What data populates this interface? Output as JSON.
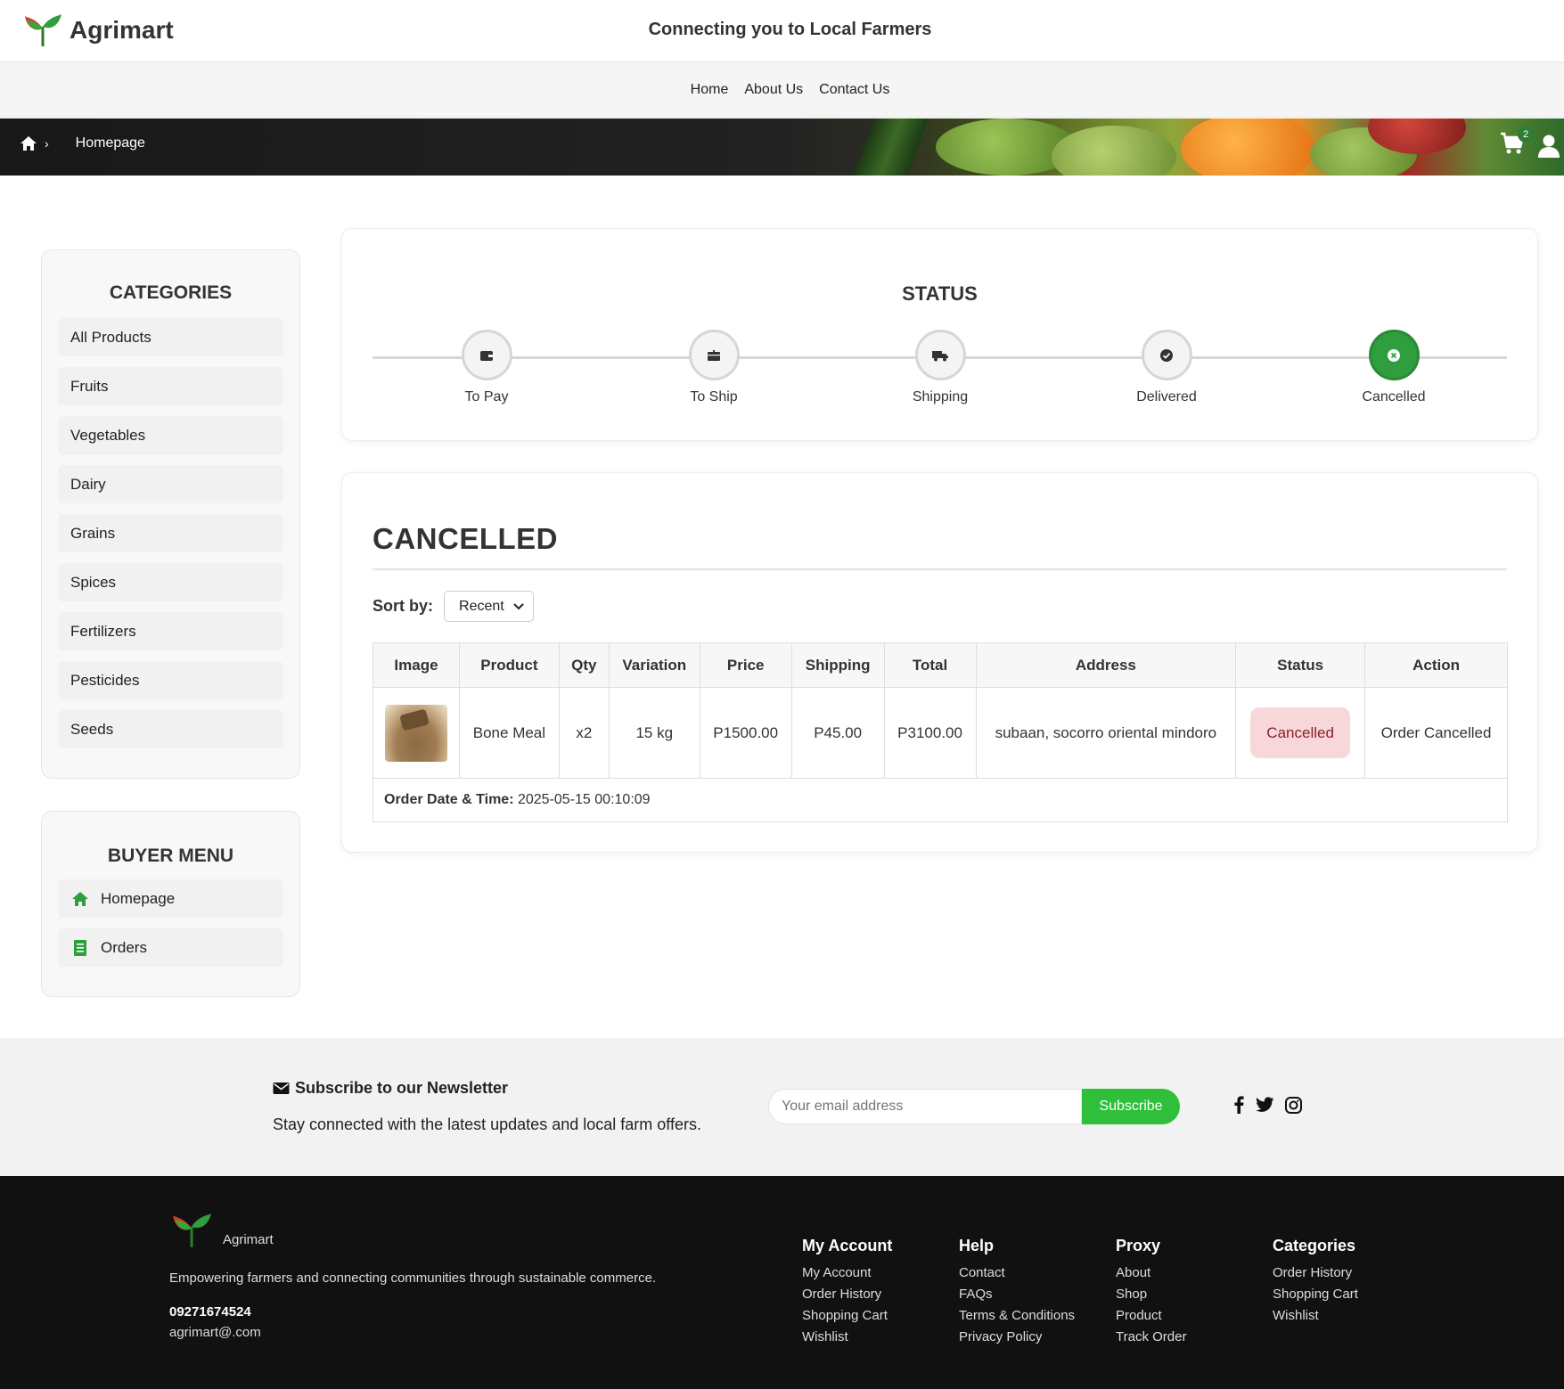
{
  "header": {
    "brand": "Agrimart",
    "tagline": "Connecting you to Local Farmers"
  },
  "nav": {
    "links": [
      "Home",
      "About Us",
      "Contact Us"
    ]
  },
  "breadcrumb": {
    "current": "Homepage",
    "separator": "›"
  },
  "cart": {
    "count": "2"
  },
  "sidebar": {
    "categories_title": "CATEGORIES",
    "categories": [
      "All Products",
      "Fruits",
      "Vegetables",
      "Dairy",
      "Grains",
      "Spices",
      "Fertilizers",
      "Pesticides",
      "Seeds"
    ],
    "buyer_menu_title": "BUYER MENU",
    "buyer_menu": [
      {
        "label": "Homepage",
        "icon": "home-icon"
      },
      {
        "label": "Orders",
        "icon": "receipt-icon"
      }
    ]
  },
  "status": {
    "title": "STATUS",
    "steps": [
      {
        "label": "To Pay",
        "icon": "wallet-icon",
        "active": false
      },
      {
        "label": "To Ship",
        "icon": "box-icon",
        "active": false
      },
      {
        "label": "Shipping",
        "icon": "truck-icon",
        "active": false
      },
      {
        "label": "Delivered",
        "icon": "check-circle-icon",
        "active": false
      },
      {
        "label": "Cancelled",
        "icon": "x-circle-icon",
        "active": true
      }
    ]
  },
  "orders": {
    "title": "CANCELLED",
    "sort_label": "Sort by:",
    "sort_value": "Recent",
    "columns": [
      "Image",
      "Product",
      "Qty",
      "Variation",
      "Price",
      "Shipping",
      "Total",
      "Address",
      "Status",
      "Action"
    ],
    "rows": [
      {
        "product": "Bone Meal",
        "qty": "x2",
        "variation": "15 kg",
        "price": "P1500.00",
        "shipping": "P45.00",
        "total": "P3100.00",
        "address": "subaan, socorro oriental mindoro",
        "status": "Cancelled",
        "action": "Order Cancelled",
        "order_date_label": "Order Date & Time:",
        "order_date": "2025-05-15 00:10:09"
      }
    ]
  },
  "newsletter": {
    "title": "Subscribe to our Newsletter",
    "subtitle": "Stay connected with the latest updates and local farm offers.",
    "placeholder": "Your email address",
    "button": "Subscribe"
  },
  "footer": {
    "brand": "Agrimart",
    "description": "Empowering farmers and connecting communities through sustainable commerce.",
    "phone": "09271674524",
    "email": "agrimart@.com",
    "columns": [
      {
        "title": "My Account",
        "links": [
          "My Account",
          "Order History",
          "Shopping Cart",
          "Wishlist"
        ]
      },
      {
        "title": "Help",
        "links": [
          "Contact",
          "FAQs",
          "Terms & Conditions",
          "Privacy Policy"
        ]
      },
      {
        "title": "Proxy",
        "links": [
          "About",
          "Shop",
          "Product",
          "Track Order"
        ]
      },
      {
        "title": "Categories",
        "links": [
          "Order History",
          "Shopping Cart",
          "Wishlist"
        ]
      }
    ]
  },
  "colors": {
    "brand_green": "#2e9e3e",
    "subscribe_green": "#2fbf3b",
    "cancelled_badge_bg": "#f8d7da",
    "cancelled_badge_text": "#8b1f2a",
    "footer_bg": "#111111"
  }
}
